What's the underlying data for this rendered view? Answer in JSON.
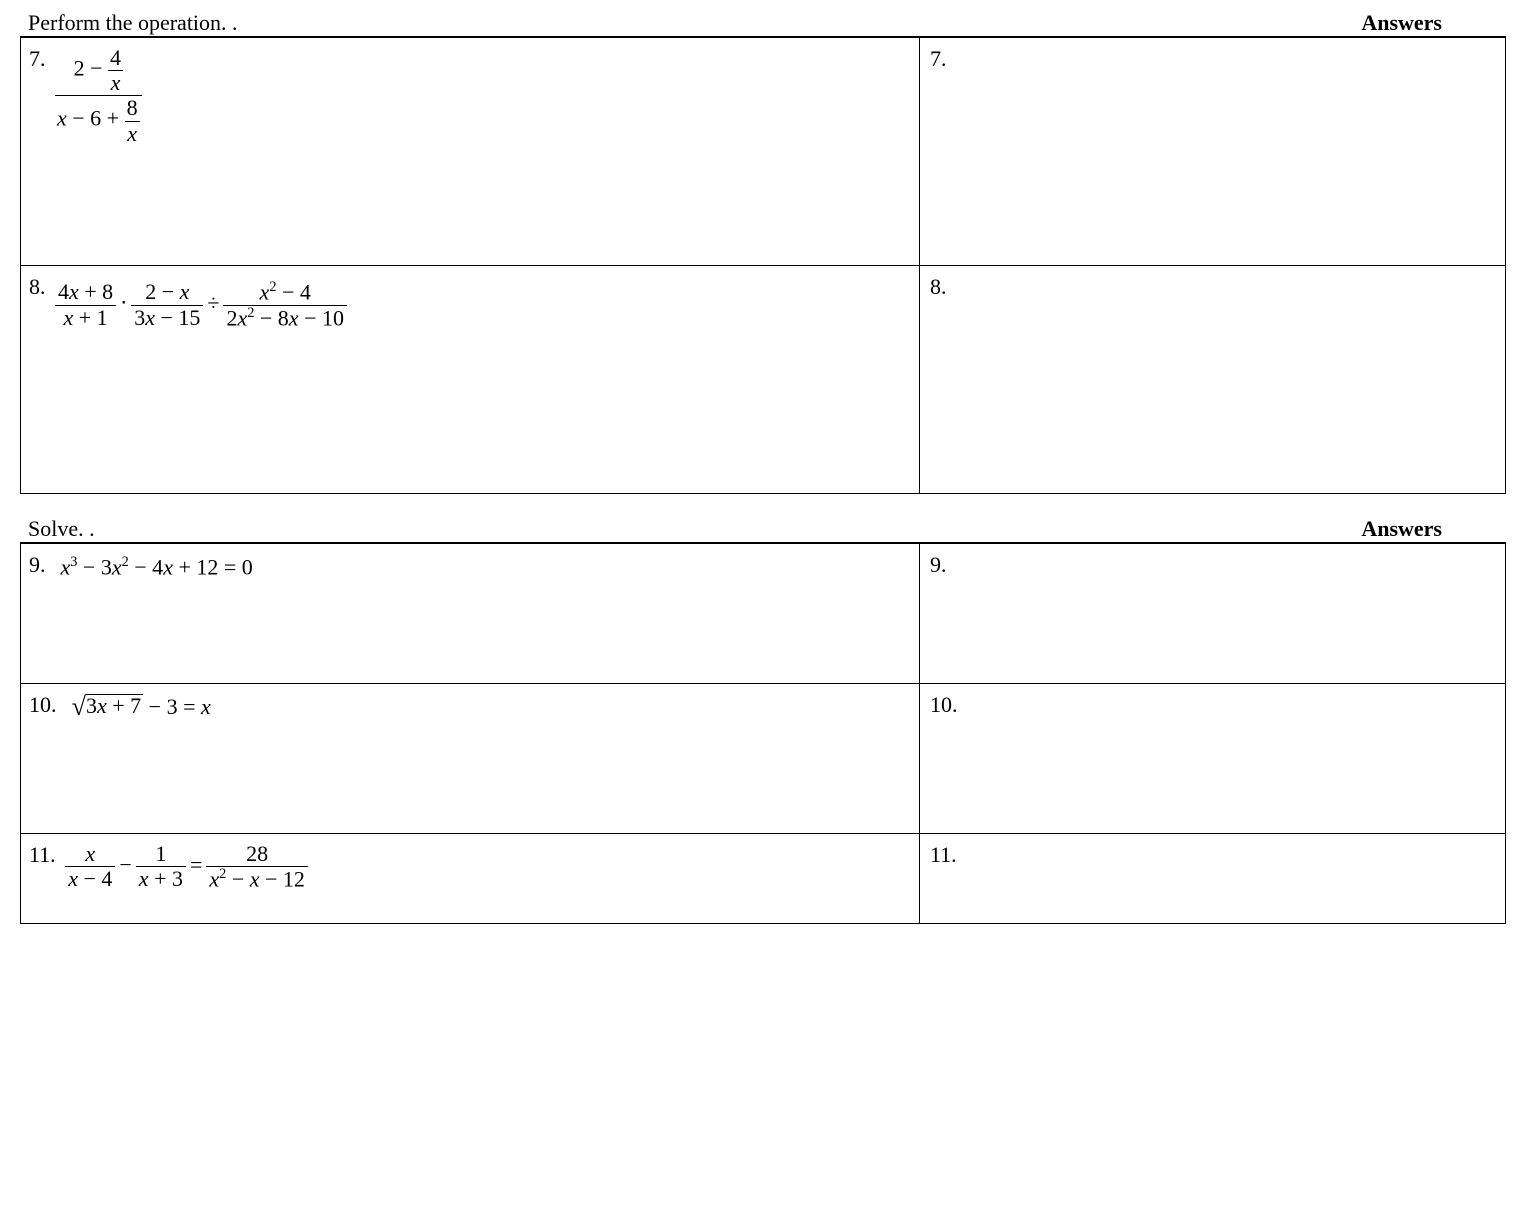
{
  "section1": {
    "title": "Perform the operation. .",
    "answers_label": "Answers"
  },
  "section2": {
    "title": "Solve. .",
    "answers_label": "Answers"
  },
  "problems": {
    "p7": {
      "num": "7.",
      "ans": "7."
    },
    "p8": {
      "num": "8.",
      "ans": "8."
    },
    "p9": {
      "num": "9.",
      "ans": "9."
    },
    "p10": {
      "num": "10.",
      "ans": "10."
    },
    "p11": {
      "num": "11.",
      "ans": "11."
    }
  },
  "chart_data": {
    "type": "table",
    "problems": [
      {
        "id": 7,
        "instruction": "Perform the operation.",
        "expression": "(2 - 4/x) / (x - 6 + 8/x)"
      },
      {
        "id": 8,
        "instruction": "Perform the operation.",
        "expression": "(4x+8)/(x+1) · (2-x)/(3x-15) ÷ (x^2-4)/(2x^2-8x-10)"
      },
      {
        "id": 9,
        "instruction": "Solve.",
        "expression": "x^3 - 3x^2 - 4x + 12 = 0"
      },
      {
        "id": 10,
        "instruction": "Solve.",
        "expression": "sqrt(3x+7) - 3 = x"
      },
      {
        "id": 11,
        "instruction": "Solve.",
        "expression": "x/(x-4) - 1/(x+3) = 28/(x^2 - x - 12)"
      }
    ]
  }
}
